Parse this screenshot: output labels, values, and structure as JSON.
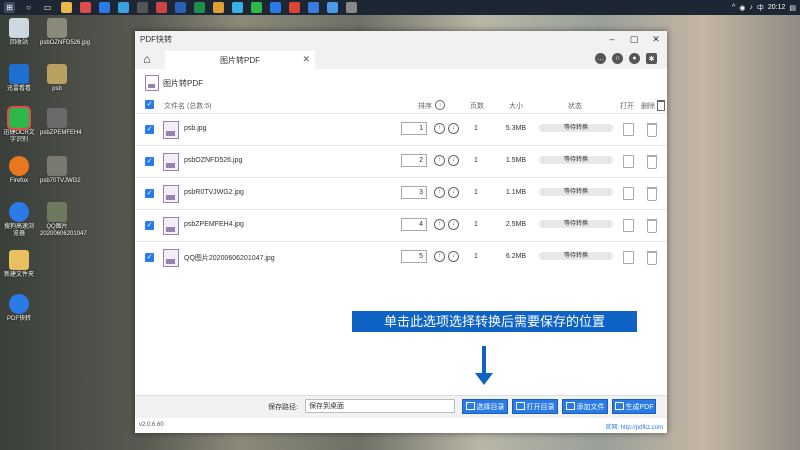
{
  "taskbar": {
    "time": "20:12",
    "icons": [
      "start-icon",
      "search-icon",
      "taskview-icon",
      "folder-icon",
      "browser-icon",
      "edge-icon",
      "store-icon",
      "media-icon",
      "game-icon",
      "word-icon",
      "excel-icon",
      "paint-icon",
      "chat-icon",
      "wechat-icon",
      "tencent-icon",
      "video-icon",
      "doc-icon",
      "drive-icon",
      "settings-icon"
    ]
  },
  "desktop": {
    "items": [
      {
        "label": "回收站"
      },
      {
        "label": "psbOZNFD526.jpg"
      },
      {
        "label": "迅雷看看"
      },
      {
        "label": "psb"
      },
      {
        "label": "迅捷OCR文字识别"
      },
      {
        "label": "psbZPEMFEH4"
      },
      {
        "label": "Firefox"
      },
      {
        "label": "psb70TVJWG2"
      },
      {
        "label": "搜狗高速浏览器"
      },
      {
        "label": "QQ图片20200606201047"
      },
      {
        "label": "新建文件夹"
      },
      {
        "label": "PDF快转"
      }
    ]
  },
  "window": {
    "title": "PDF快转",
    "tab_label": "图片转PDF",
    "heading": "图片转PDF"
  },
  "table": {
    "col_name": "文件名 (总数:5)",
    "col_order": "排序",
    "col_pages": "页数",
    "col_size": "大小",
    "col_status": "状态",
    "col_open": "打开",
    "col_delete": "删除",
    "rows": [
      {
        "name": "psb.jpg",
        "order": "1",
        "pages": "1",
        "size": "5.3MB",
        "status": "等待转换"
      },
      {
        "name": "psbOZNFD526.jpg",
        "order": "2",
        "pages": "1",
        "size": "1.5MB",
        "status": "等待转换"
      },
      {
        "name": "psbR0TVJWG2.jpg",
        "order": "3",
        "pages": "1",
        "size": "1.1MB",
        "status": "等待转换"
      },
      {
        "name": "psbZPEMFEH4.jpg",
        "order": "4",
        "pages": "1",
        "size": "2.5MB",
        "status": "等待转换"
      },
      {
        "name": "QQ图片20200606201047.jpg",
        "order": "5",
        "pages": "1",
        "size": "6.2MB",
        "status": "等待转换"
      }
    ]
  },
  "tooltip": "单击此选项选择转换后需要保存的位置",
  "bottom": {
    "save_label": "保存路径:",
    "save_path": "保存到桌面",
    "btn_select_dir": "选择目录",
    "btn_open_dir": "打开目录",
    "btn_add_file": "添加文件",
    "btn_generate": "生成PDF"
  },
  "footer": {
    "version": "v2.0.6.60",
    "website": "官网: http://pdfkz.com"
  },
  "colors": {
    "accent": "#2b7be6",
    "tooltip": "#0f63c4"
  }
}
